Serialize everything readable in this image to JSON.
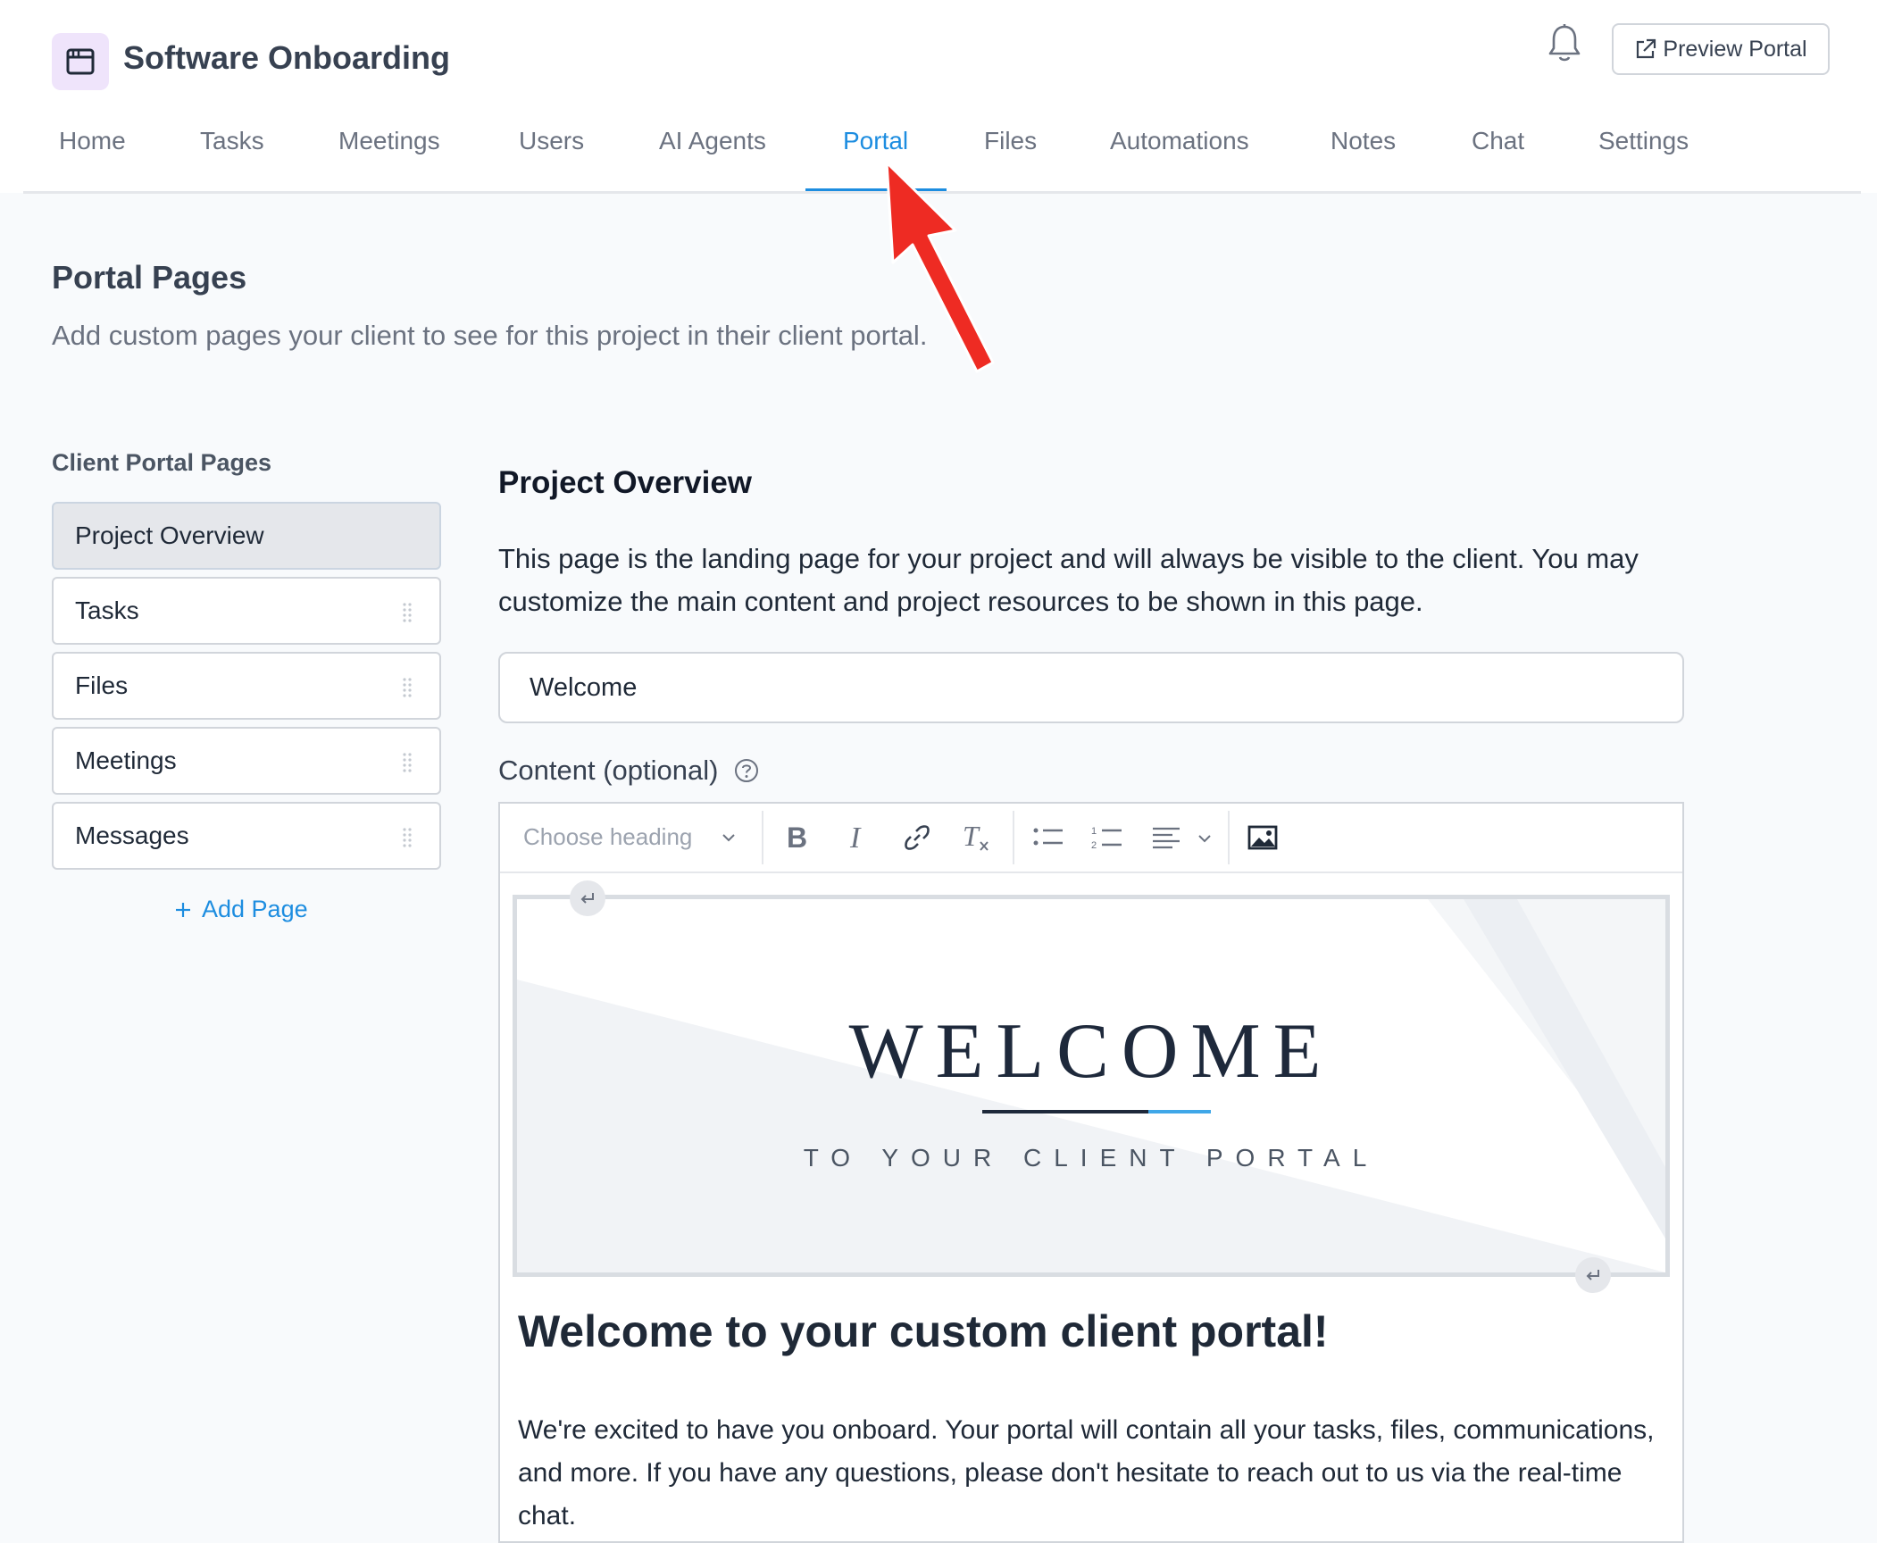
{
  "app": {
    "title": "Software Onboarding",
    "icon": "browser-window-icon",
    "accent_color": "#1d8de0"
  },
  "header": {
    "preview_button_label": "Preview Portal",
    "notification_icon": "bell-icon"
  },
  "nav": {
    "tabs": [
      {
        "label": "Home",
        "active": false
      },
      {
        "label": "Tasks",
        "active": false
      },
      {
        "label": "Meetings",
        "active": false
      },
      {
        "label": "Users",
        "active": false
      },
      {
        "label": "AI Agents",
        "active": false
      },
      {
        "label": "Portal",
        "active": true
      },
      {
        "label": "Files",
        "active": false
      },
      {
        "label": "Automations",
        "active": false
      },
      {
        "label": "Notes",
        "active": false
      },
      {
        "label": "Chat",
        "active": false
      },
      {
        "label": "Settings",
        "active": false
      }
    ]
  },
  "page": {
    "title": "Portal Pages",
    "subtitle": "Add custom pages your client to see for this project in their client portal."
  },
  "sidebar": {
    "heading": "Client Portal Pages",
    "pages": [
      {
        "label": "Project Overview",
        "selected": true
      },
      {
        "label": "Tasks",
        "selected": false
      },
      {
        "label": "Files",
        "selected": false
      },
      {
        "label": "Meetings",
        "selected": false
      },
      {
        "label": "Messages",
        "selected": false
      }
    ],
    "add_page_label": "Add Page"
  },
  "main": {
    "section_title": "Project Overview",
    "description": "This page is the landing page for your project and will always be visible to the client. You may customize the main content and project resources to be shown in this page.",
    "title_input_value": "Welcome",
    "content_label": "Content (optional)",
    "editor": {
      "heading_select": "Choose heading",
      "toolbar_icons": [
        "bold-icon",
        "italic-icon",
        "link-icon",
        "clear-format-icon",
        "bulleted-list-icon",
        "numbered-list-icon",
        "align-icon",
        "image-icon"
      ],
      "banner": {
        "title": "WELCOME",
        "subtitle": "TO YOUR CLIENT PORTAL"
      },
      "content_heading": "Welcome to your custom client portal!",
      "content_body": "We're excited to have you onboard. Your portal will contain all your tasks, files, communications, and more. If you have any questions, please don't hesitate to reach out to us via the real-time chat."
    }
  },
  "annotation": {
    "arrow_color": "#ee2b23"
  }
}
